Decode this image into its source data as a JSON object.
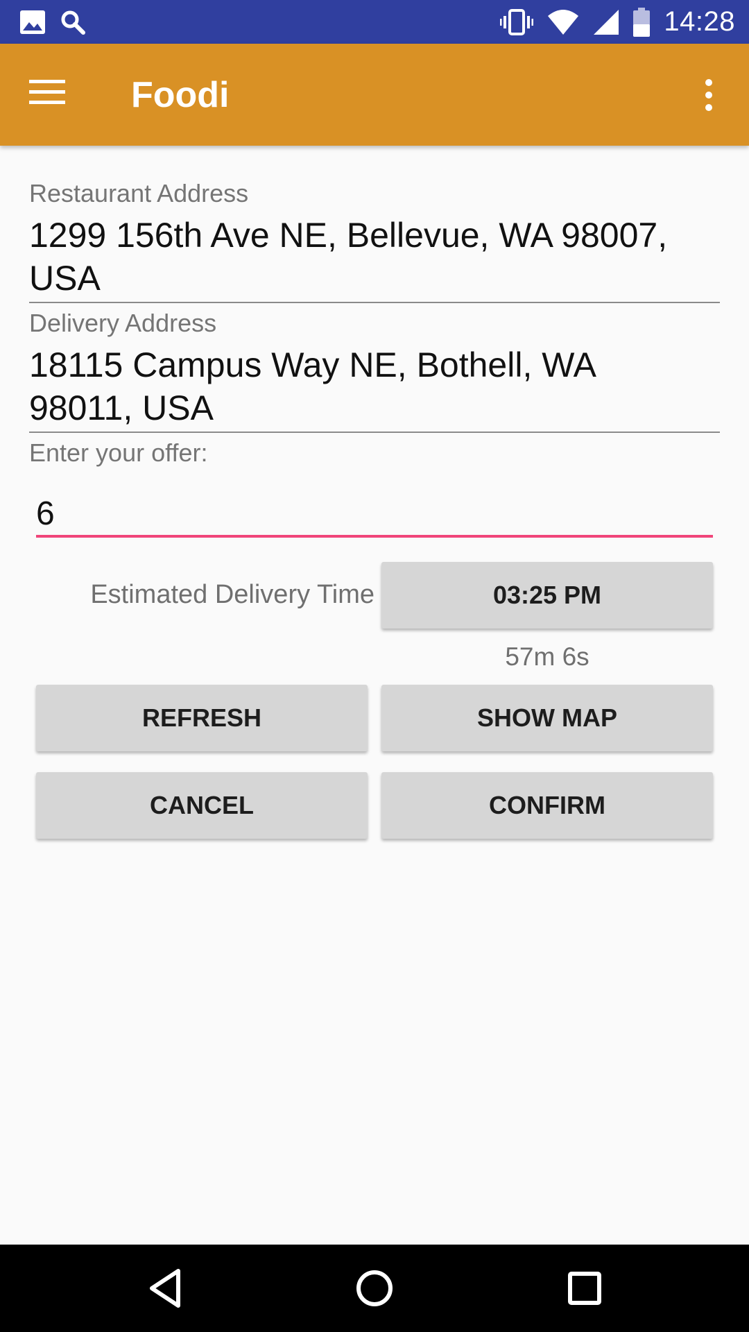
{
  "status_bar": {
    "time": "14:28",
    "icons": [
      "image-icon",
      "search-icon",
      "vibrate-icon",
      "wifi-icon",
      "signal-icon",
      "battery-icon"
    ]
  },
  "app_bar": {
    "title": "Foodi",
    "background_color": "#d99125",
    "icons": [
      "menu-icon",
      "more-vert-icon"
    ]
  },
  "form": {
    "restaurant_label": "Restaurant Address",
    "restaurant_value_line1": "1299 156th Ave NE, Bellevue, WA 98007,",
    "restaurant_value_line2": "USA",
    "delivery_label": "Delivery Address",
    "delivery_value_line1": "18115 Campus Way NE, Bothell, WA",
    "delivery_value_line2": "98011, USA",
    "offer_label": "Enter your offer:",
    "offer_value": "6",
    "offer_accent_color": "#f0457a",
    "estimated_label": "Estimated Delivery Time",
    "estimated_time": "03:25 PM",
    "countdown": "57m 6s"
  },
  "buttons": {
    "refresh": "REFRESH",
    "show_map": "SHOW MAP",
    "cancel": "CANCEL",
    "confirm": "CONFIRM"
  },
  "nav_bar": {
    "icons": [
      "back-icon",
      "home-icon",
      "recents-icon"
    ]
  }
}
